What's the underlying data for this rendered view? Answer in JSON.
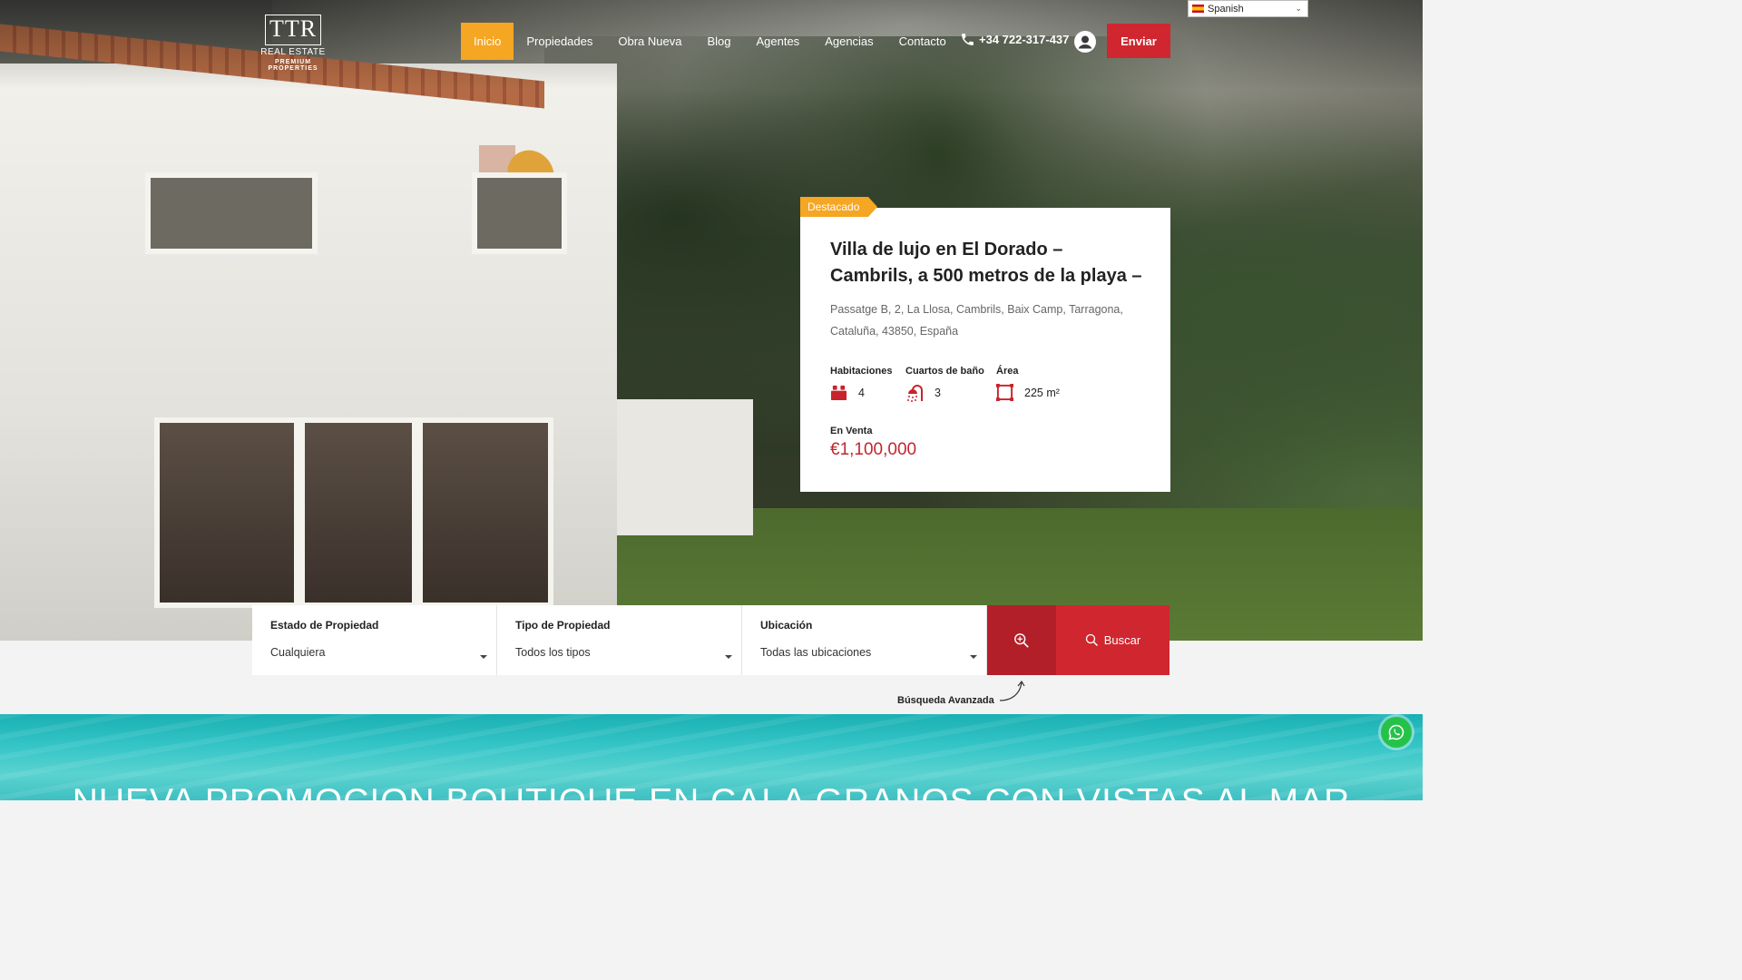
{
  "language_selector": {
    "value": "Spanish"
  },
  "logo": {
    "mark": "TTR",
    "line1": "REAL ESTATE",
    "line2": "PREMIUM PROPERTIES"
  },
  "nav": {
    "items": [
      {
        "label": "Inicio",
        "active": true
      },
      {
        "label": "Propiedades"
      },
      {
        "label": "Obra Nueva"
      },
      {
        "label": "Blog"
      },
      {
        "label": "Agentes"
      },
      {
        "label": "Agencias"
      },
      {
        "label": "Contacto"
      }
    ],
    "phone": "+34 722-317-437",
    "submit_label": "Enviar"
  },
  "featured": {
    "badge": "Destacado",
    "title": "Villa de lujo en El Dorado – Cambrils, a 500 metros de la playa –",
    "address": "Passatge B, 2, La Llosa, Cambrils, Baix Camp, Tarragona, Cataluña, 43850, España",
    "specs": {
      "bedrooms": {
        "label": "Habitaciones",
        "value": "4"
      },
      "bathrooms": {
        "label": "Cuartos de baño",
        "value": "3"
      },
      "area": {
        "label": "Área",
        "value": "225 m²"
      }
    },
    "status": "En Venta",
    "price": "€1,100,000"
  },
  "search": {
    "status": {
      "label": "Estado de Propiedad",
      "value": "Cualquiera"
    },
    "type": {
      "label": "Tipo de Propiedad",
      "value": "Todos los tipos"
    },
    "location": {
      "label": "Ubicación",
      "value": "Todas las ubicaciones"
    },
    "button_label": "Buscar",
    "advanced_label": "Búsqueda Avanzada"
  },
  "promo": {
    "heading": "NUEVA PROMOCION BOUTIQUE EN CALA GRANOS CON VISTAS AL MAR"
  },
  "colors": {
    "accent": "#f5a623",
    "brand_red": "#d0262f",
    "price": "#c0272d"
  }
}
